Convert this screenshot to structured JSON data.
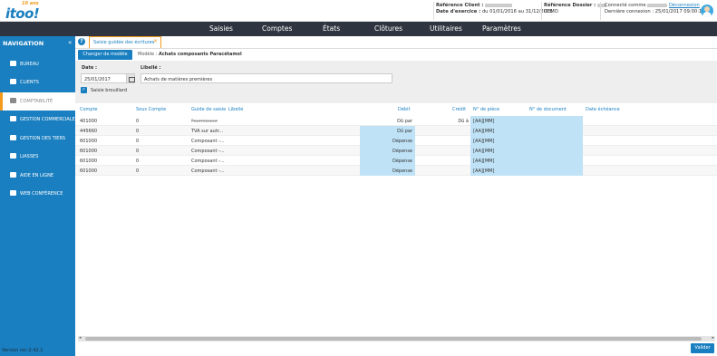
{
  "logo": {
    "brand": "itoo!",
    "tagline": "10 ans"
  },
  "header": {
    "ref_client_label": "Référence Client :",
    "exercise_label": "Date d'exercice :",
    "exercise_value": "du 01/01/2016 au 31/12/2016",
    "ref_dossier_label": "Référence Dossier :",
    "dossier_value": "DEMO",
    "connected_label": "Connecté comme",
    "logout_label": "Déconnexion",
    "last_login": "Dernière connexion : 25/01/2017 09:00:14"
  },
  "mainnav": [
    "Saisies",
    "Comptes",
    "États",
    "Clôtures",
    "Utilitaires",
    "Paramètres"
  ],
  "sidebar": {
    "title": "NAVIGATION",
    "collapse": "«",
    "items": [
      {
        "label": "BUREAU",
        "icon": "chart-icon"
      },
      {
        "label": "CLIENTS",
        "icon": "car-icon"
      },
      {
        "label": "COMPTABILITÉ",
        "icon": "calculator-icon"
      },
      {
        "label": "GESTION COMMERCIALE",
        "icon": "card-icon"
      },
      {
        "label": "GESTION DES TIERS",
        "icon": "users-icon"
      },
      {
        "label": "LIASSES",
        "icon": "folder-icon"
      },
      {
        "label": "AIDE EN LIGNE",
        "icon": "book-icon"
      },
      {
        "label": "WEB CONFÉRENCE",
        "icon": "monitor-icon"
      }
    ],
    "active_index": 2,
    "version": "Version rec-2.42.1"
  },
  "tabs": {
    "help": "?",
    "active_tab": "Saisie guidée des écritures",
    "close": "×"
  },
  "modelbar": {
    "button": "Changer de modèle",
    "model_label": "Modèle :",
    "model_value": "Achats composants Paracétamol"
  },
  "form": {
    "date_label": "Date :",
    "date_value": "25/01/2017",
    "libelle_label": "Libellé :",
    "libelle_value": "Achats de matières premières",
    "brouillard_label": "Saisie brouillard",
    "brouillard_checked": true
  },
  "grid": {
    "headers": [
      "Compte",
      "Sous Compte",
      "Guide de saisie",
      "Libellé",
      "Débit",
      "Crédit",
      "N° de pièce",
      "N° de document",
      "Date échéance"
    ],
    "rows": [
      {
        "compte": "401000",
        "sous_compte": "0",
        "guide": "Fournisseur",
        "libelle": "",
        "debit": "Dû par",
        "credit": "Dû à",
        "piece": "[AA][MM]",
        "strike": true,
        "debit_hl": false
      },
      {
        "compte": "445660",
        "sous_compte": "0",
        "guide": "TVA sur autr...",
        "libelle": "",
        "debit": "Dû par",
        "credit": "",
        "piece": "[AA][MM]",
        "strike": false,
        "debit_hl": true
      },
      {
        "compte": "601000",
        "sous_compte": "0",
        "guide": "Composant -...",
        "libelle": "",
        "debit": "Dépense",
        "credit": "",
        "piece": "[AA][MM]",
        "strike": false,
        "debit_hl": true
      },
      {
        "compte": "601000",
        "sous_compte": "0",
        "guide": "Composant -...",
        "libelle": "",
        "debit": "Dépense",
        "credit": "",
        "piece": "[AA][MM]",
        "strike": false,
        "debit_hl": true
      },
      {
        "compte": "601000",
        "sous_compte": "0",
        "guide": "Composant -...",
        "libelle": "",
        "debit": "Dépense",
        "credit": "",
        "piece": "[AA][MM]",
        "strike": false,
        "debit_hl": true
      },
      {
        "compte": "601000",
        "sous_compte": "0",
        "guide": "Composant -...",
        "libelle": "",
        "debit": "Dépense",
        "credit": "",
        "piece": "[AA][MM]",
        "strike": false,
        "debit_hl": true
      }
    ]
  },
  "footer": {
    "validate": "Valider",
    "scroll_left": "◂",
    "scroll_right": "▸"
  },
  "colors": {
    "primary": "#1a7fc0",
    "accent": "#f39a1c",
    "nav": "#2e3540",
    "highlight": "#bfe2f6"
  }
}
